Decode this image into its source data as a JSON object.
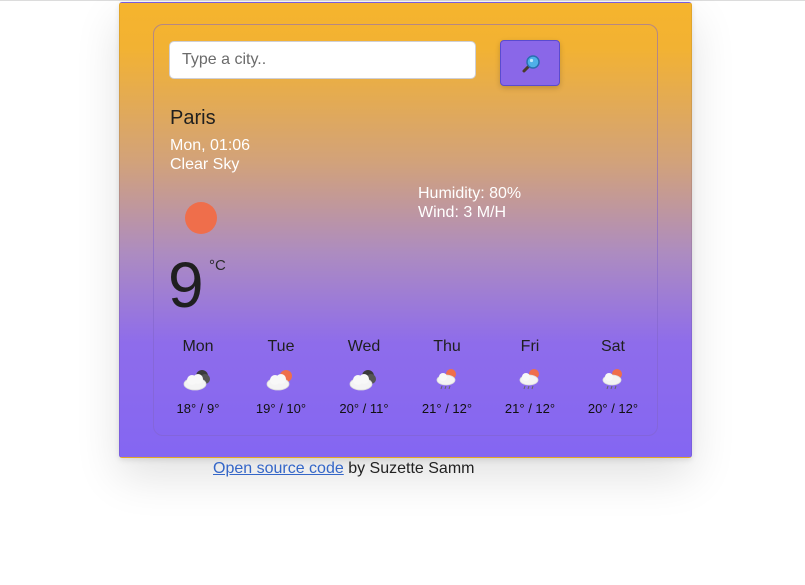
{
  "search": {
    "placeholder": "Type a city.."
  },
  "current": {
    "city": "Paris",
    "datetime": "Mon, 01:06",
    "condition": "Clear Sky",
    "icon": "sun-icon",
    "temperature": "9",
    "unit": "°C",
    "humidity": "Humidity: 80%",
    "wind": "Wind: 3 M/H"
  },
  "forecast": [
    {
      "day": "Mon",
      "temps": "18° / 9°",
      "icon": "partly-cloudy-night-icon"
    },
    {
      "day": "Tue",
      "temps": "19° / 10°",
      "icon": "partly-cloudy-day-icon"
    },
    {
      "day": "Wed",
      "temps": "20° / 11°",
      "icon": "partly-cloudy-night-icon"
    },
    {
      "day": "Thu",
      "temps": "21° / 12°",
      "icon": "rain-sun-icon"
    },
    {
      "day": "Fri",
      "temps": "21° / 12°",
      "icon": "rain-sun-icon"
    },
    {
      "day": "Sat",
      "temps": "20° / 12°",
      "icon": "rain-sun-icon"
    }
  ],
  "footer": {
    "link_text": "Open source code",
    "suffix": " by Suzette Samm"
  },
  "colors": {
    "gradient_top": "#f6b42d",
    "gradient_bottom": "#8466f2",
    "sun": "#ef6e4b",
    "button": "#8a67e8"
  }
}
